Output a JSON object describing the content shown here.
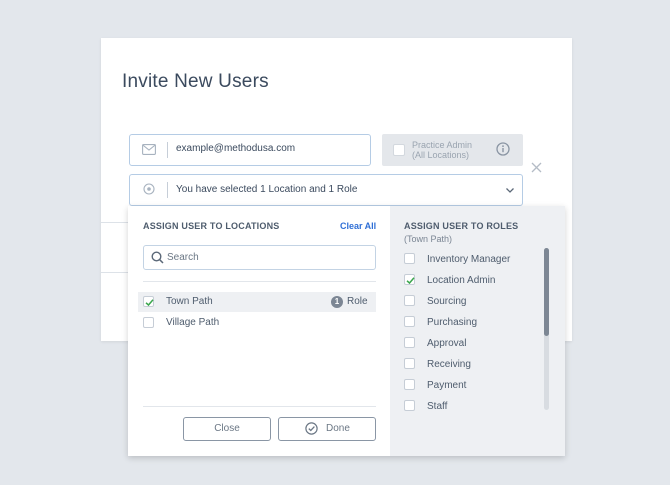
{
  "modal": {
    "title": "Invite New Users",
    "email": {
      "value": "example@methodusa.com",
      "icon": "envelope-icon"
    },
    "practice_admin": {
      "line1": "Practice Admin",
      "line2": "(All Locations)",
      "checked": false,
      "icon": "info-icon"
    },
    "location_select": {
      "text": "You have selected 1 Location and 1 Role",
      "icon": "location-pin-icon"
    }
  },
  "dropdown": {
    "locations": {
      "heading": "ASSIGN USER TO LOCATIONS",
      "clear_all": "Clear All",
      "search_placeholder": "Search",
      "items": [
        {
          "label": "Town Path",
          "checked": true,
          "selected": true,
          "role_count": "1",
          "role_label": "Role"
        },
        {
          "label": "Village Path",
          "checked": false,
          "selected": false
        }
      ],
      "close_label": "Close",
      "done_label": "Done"
    },
    "roles": {
      "heading": "ASSIGN USER TO ROLES",
      "subheading": "(Town Path)",
      "items": [
        {
          "label": "Inventory Manager",
          "checked": false
        },
        {
          "label": "Location Admin",
          "checked": true
        },
        {
          "label": "Sourcing",
          "checked": false
        },
        {
          "label": "Purchasing",
          "checked": false
        },
        {
          "label": "Approval",
          "checked": false
        },
        {
          "label": "Receiving",
          "checked": false
        },
        {
          "label": "Payment",
          "checked": false
        },
        {
          "label": "Staff",
          "checked": false
        }
      ]
    }
  },
  "colors": {
    "accent": "#2f6fd6",
    "check": "#3aa64d",
    "field_border": "#b5cce5"
  }
}
